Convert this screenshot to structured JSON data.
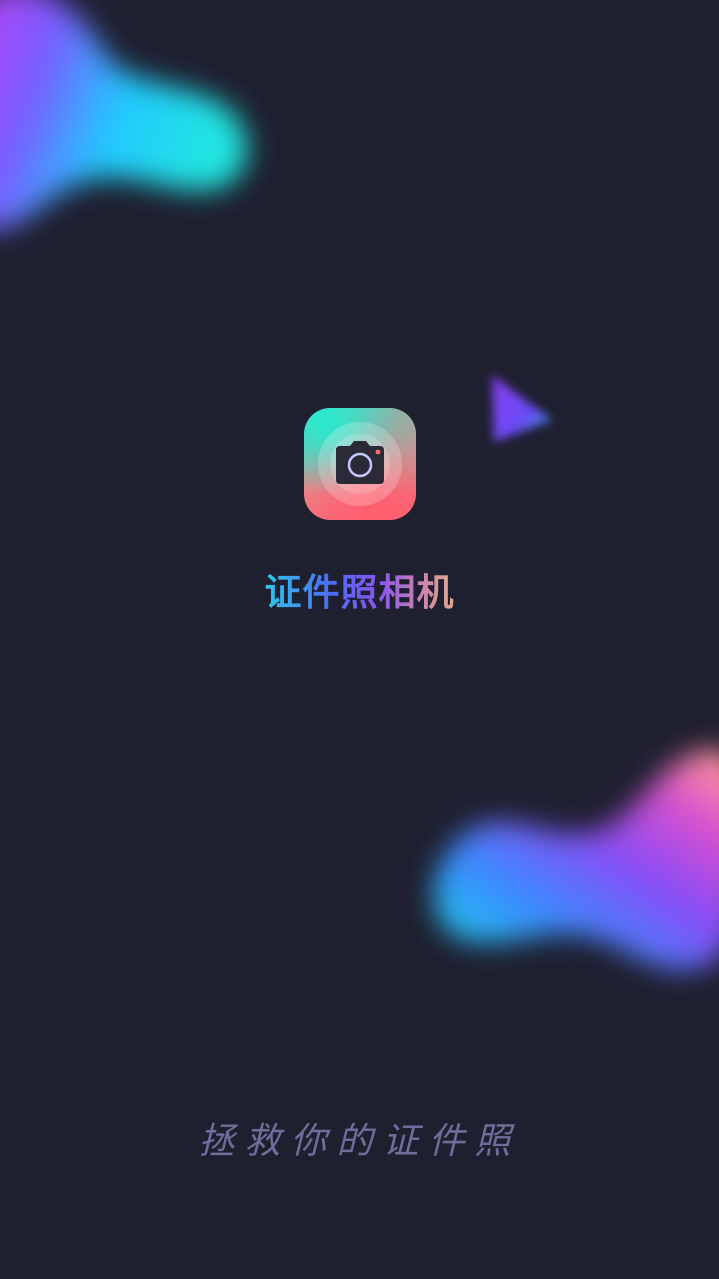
{
  "app": {
    "title": "证件照相机",
    "slogan": "拯救你的证件照"
  },
  "icons": {
    "app_icon": "camera-icon"
  },
  "colors": {
    "background": "#1e1f2f",
    "title_gradient": [
      "#2fc6e8",
      "#4c6bf5",
      "#8a55f0",
      "#d08aa8",
      "#e0a98c"
    ],
    "slogan": "#6b6f9a",
    "icon_gradient": [
      "#37e3cf",
      "#ff5a6c"
    ]
  }
}
